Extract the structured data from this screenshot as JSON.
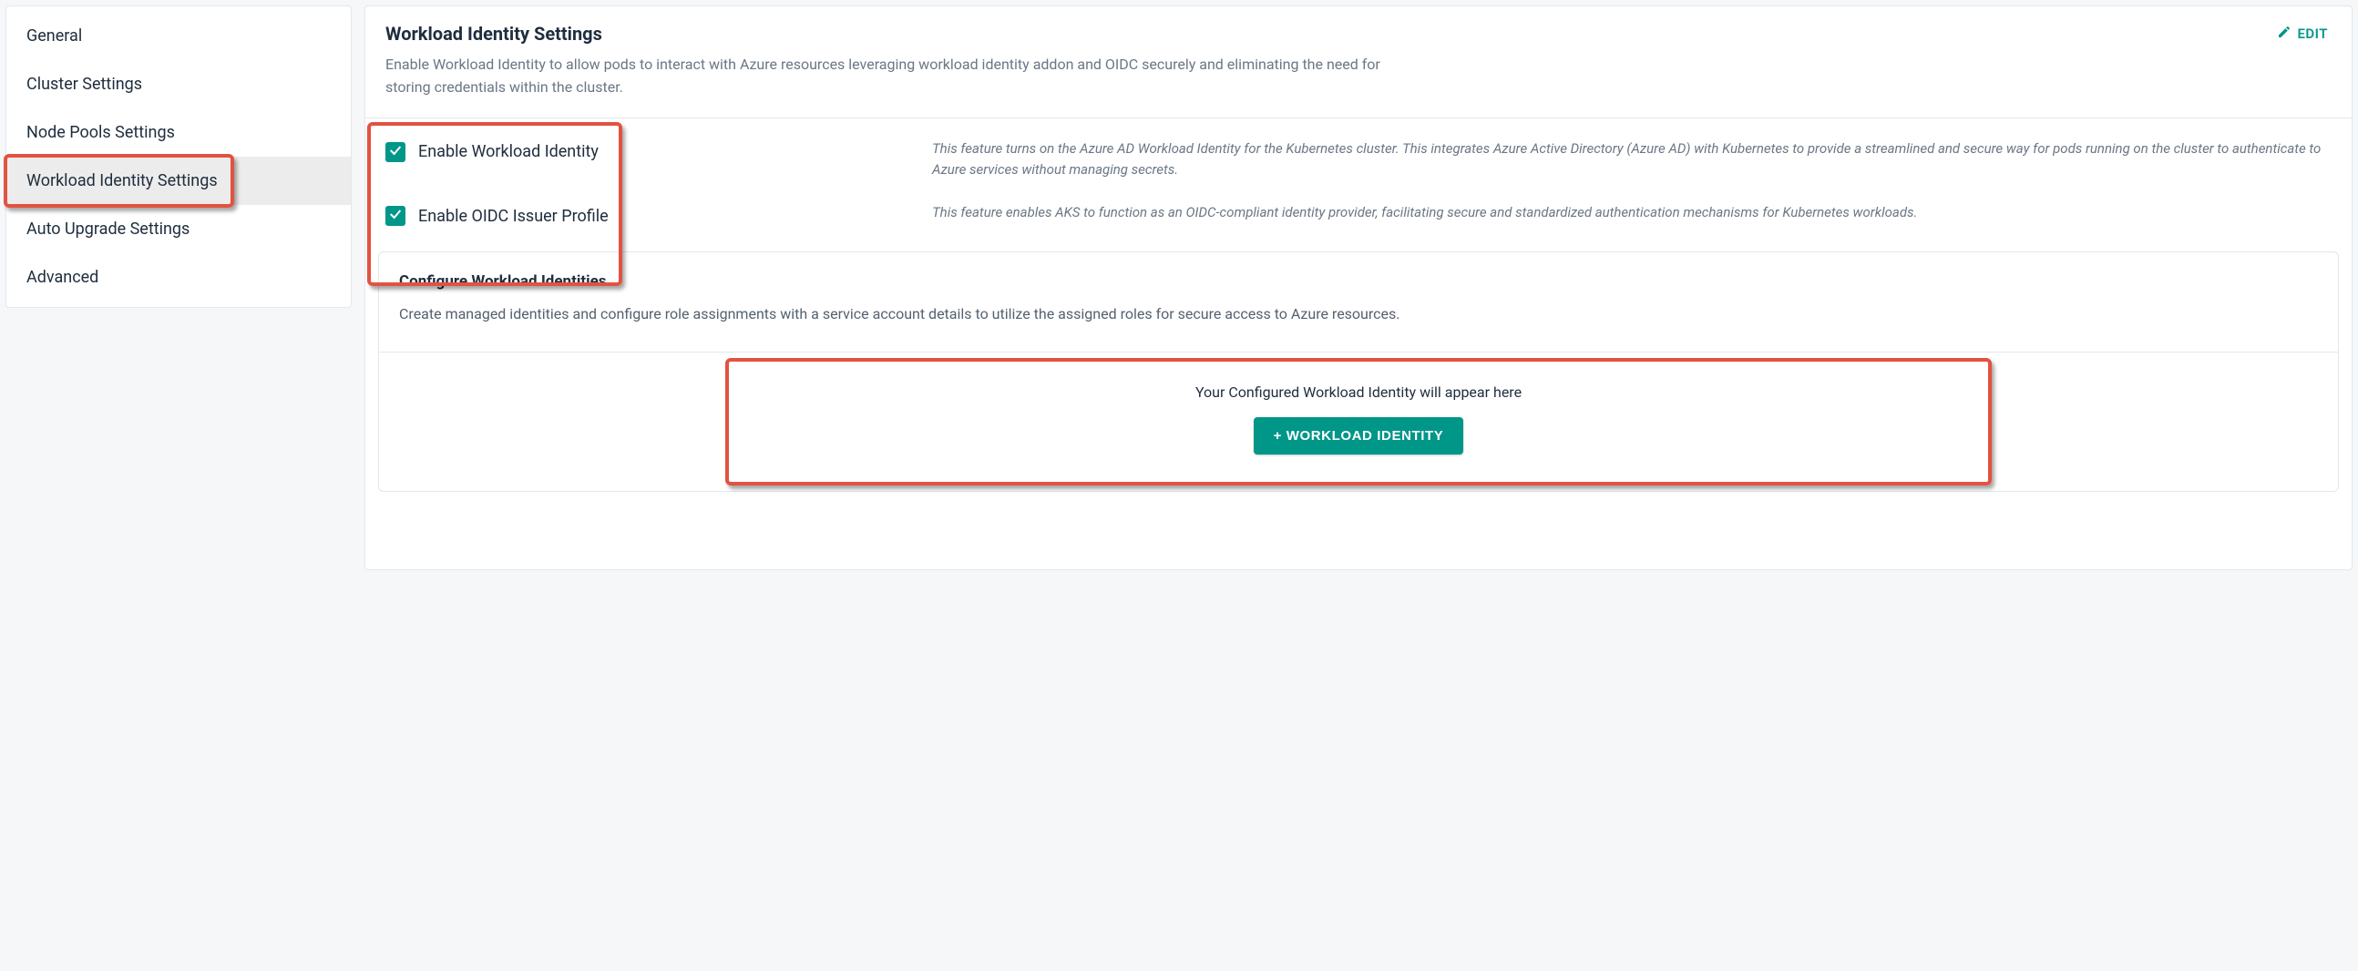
{
  "colors": {
    "accent": "#009688",
    "highlight": "#e25241"
  },
  "sidebar": {
    "items": [
      {
        "label": "General"
      },
      {
        "label": "Cluster Settings"
      },
      {
        "label": "Node Pools Settings"
      },
      {
        "label": "Workload Identity Settings",
        "active": true
      },
      {
        "label": "Auto Upgrade Settings"
      },
      {
        "label": "Advanced"
      }
    ]
  },
  "header": {
    "title": "Workload Identity Settings",
    "description": "Enable Workload Identity to allow pods to interact with Azure resources leveraging workload identity addon and OIDC securely and eliminating the need for storing credentials within the cluster.",
    "edit_label": "EDIT",
    "edit_icon": "pencil-icon"
  },
  "options": [
    {
      "label": "Enable Workload Identity",
      "checked": true,
      "description": "This feature turns on the Azure AD Workload Identity for the Kubernetes cluster. This integrates Azure Active Directory (Azure AD) with Kubernetes to provide a streamlined and secure way for pods running on the cluster to authenticate to Azure services without managing secrets."
    },
    {
      "label": "Enable OIDC Issuer Profile",
      "checked": true,
      "description": "This feature enables AKS to function as an OIDC-compliant identity provider, facilitating secure and standardized authentication mechanisms for Kubernetes workloads."
    }
  ],
  "configure": {
    "title": "Configure Workload Identities",
    "description": "Create managed identities and configure role assignments with a service account details to utilize the assigned roles for secure access to Azure resources.",
    "placeholder": "Your Configured Workload Identity will appear here",
    "button_label": "+ WORKLOAD IDENTITY"
  }
}
